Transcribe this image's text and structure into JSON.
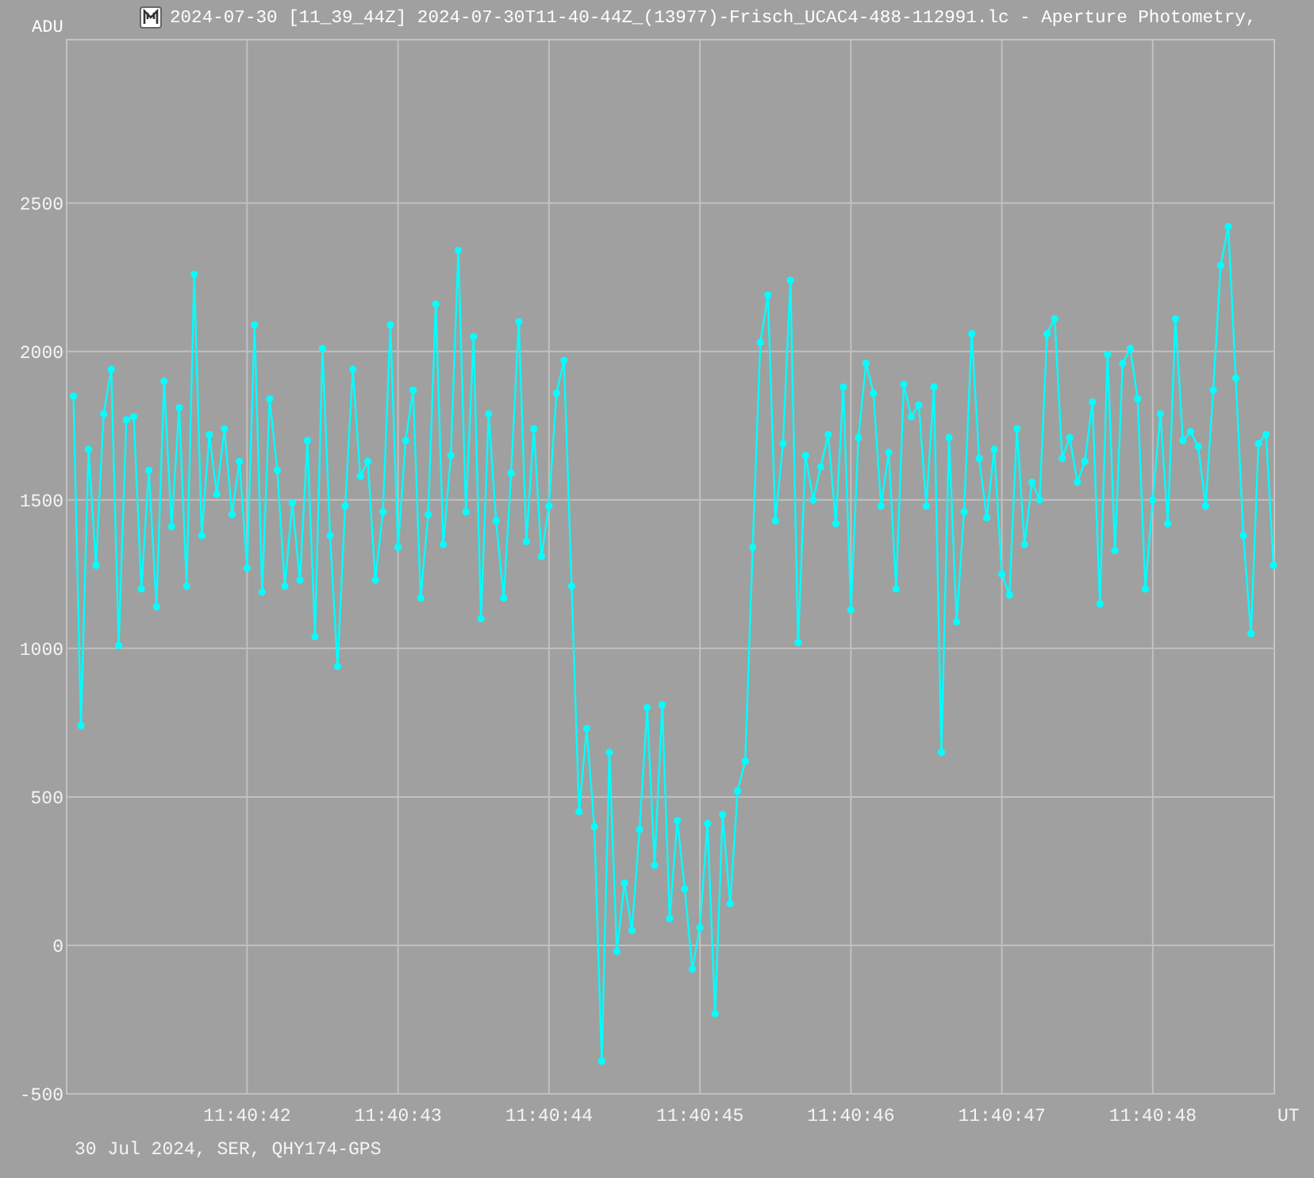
{
  "window": {
    "title": "2024-07-30 [11_39_44Z] 2024-07-30T11-40-44Z_(13977)-Frisch_UCAC4-488-112991.lc - Aperture Photometry,"
  },
  "chart": {
    "caption": "30 Jul 2024, SER, QHY174-GPS",
    "chart_data": {
      "type": "line",
      "grid": true,
      "ylabel": "ADU",
      "xlabel": "UT",
      "categories": [
        null,
        null,
        null,
        null,
        null,
        null,
        null,
        null,
        null,
        null,
        null,
        null,
        null,
        null,
        null,
        null,
        null,
        null,
        null,
        null,
        null,
        null,
        null,
        "11:40:42",
        null,
        null,
        null,
        null,
        null,
        null,
        null,
        null,
        null,
        null,
        null,
        null,
        null,
        null,
        null,
        null,
        null,
        null,
        null,
        "11:40:43",
        null,
        null,
        null,
        null,
        null,
        null,
        null,
        null,
        null,
        null,
        null,
        null,
        null,
        null,
        null,
        null,
        null,
        null,
        null,
        "11:40:44",
        null,
        null,
        null,
        null,
        null,
        null,
        null,
        null,
        null,
        null,
        null,
        null,
        null,
        null,
        null,
        null,
        null,
        null,
        null,
        "11:40:45",
        null,
        null,
        null,
        null,
        null,
        null,
        null,
        null,
        null,
        null,
        null,
        null,
        null,
        null,
        null,
        null,
        null,
        null,
        null,
        "11:40:46",
        null,
        null,
        null,
        null,
        null,
        null,
        null,
        null,
        null,
        null,
        null,
        null,
        null,
        null,
        null,
        null,
        null,
        null,
        null,
        "11:40:47",
        null,
        null,
        null,
        null,
        null,
        null,
        null,
        null,
        null,
        null,
        null,
        null,
        null,
        null,
        null,
        null,
        null,
        null,
        null,
        "11:40:48",
        null,
        null,
        null,
        null,
        null,
        null,
        null,
        null,
        null,
        null,
        null,
        null,
        null,
        null,
        null,
        null
      ],
      "series": [
        {
          "color": "#00ffff",
          "values": [
            1850,
            740,
            1670,
            1280,
            1790,
            1940,
            1010,
            1770,
            1780,
            1200,
            1600,
            1140,
            1900,
            1410,
            1810,
            1210,
            2260,
            1380,
            1720,
            1520,
            1740,
            1450,
            1630,
            1270,
            2090,
            1190,
            1840,
            1600,
            1210,
            1490,
            1230,
            1700,
            1040,
            2010,
            1380,
            940,
            1480,
            1940,
            1580,
            1630,
            1230,
            1460,
            2090,
            1340,
            1700,
            1870,
            1170,
            1450,
            2160,
            1350,
            1650,
            2340,
            1460,
            2050,
            1100,
            1790,
            1430,
            1170,
            1590,
            2100,
            1360,
            1740,
            1310,
            1480,
            1860,
            1970,
            1210,
            450,
            730,
            400,
            -390,
            650,
            -20,
            210,
            50,
            390,
            800,
            270,
            810,
            90,
            420,
            190,
            -80,
            60,
            410,
            -230,
            440,
            140,
            520,
            620,
            1340,
            2030,
            2190,
            1430,
            1690,
            2240,
            1020,
            1650,
            1500,
            1610,
            1720,
            1420,
            1880,
            1130,
            1710,
            1960,
            1860,
            1480,
            1660,
            1200,
            1890,
            1780,
            1820,
            1480,
            1880,
            650,
            1710,
            1090,
            1460,
            2060,
            1640,
            1440,
            1670,
            1250,
            1180,
            1740,
            1350,
            1560,
            1500,
            2060,
            2110,
            1640,
            1710,
            1560,
            1630,
            1830,
            1150,
            1990,
            1330,
            1960,
            2010,
            1840,
            1200,
            1500,
            1790,
            1420,
            2110,
            1700,
            1730,
            1680,
            1480,
            1870,
            2290,
            2420,
            1910,
            1380,
            1050,
            1690,
            1720,
            1280
          ]
        }
      ],
      "ylim": [
        -500,
        3050
      ],
      "yticks": [
        -500,
        0,
        500,
        1000,
        1500,
        2000,
        2500
      ]
    }
  }
}
